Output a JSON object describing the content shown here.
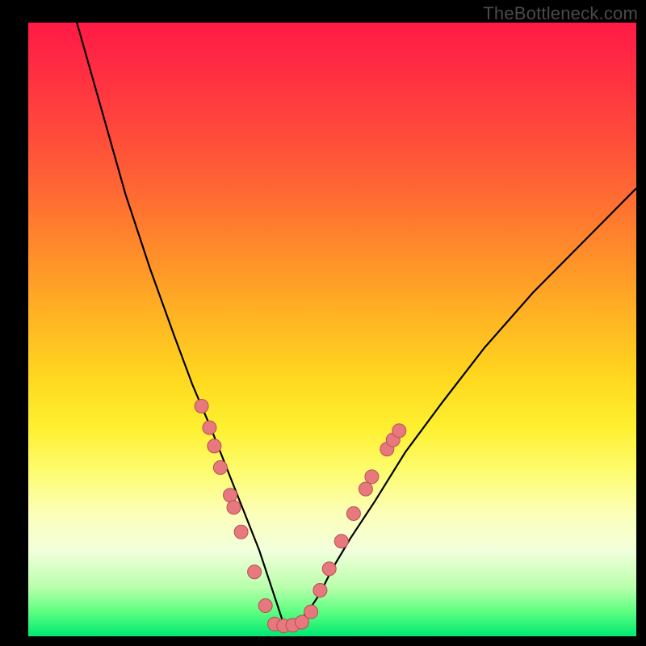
{
  "watermark": "TheBottleneck.com",
  "colors": {
    "frame_bg": "#000000",
    "curve_stroke": "#000000",
    "dot_fill": "#e6787e",
    "dot_stroke": "#b94f55"
  },
  "chart_data": {
    "type": "line",
    "title": "",
    "xlabel": "",
    "ylabel": "",
    "xlim": [
      0,
      100
    ],
    "ylim": [
      0,
      100
    ],
    "note": "Axes are unlabeled in the source image; values are geometric estimates on a 0–100 normalized scale. The curve is a V-shaped bottleneck curve with its minimum near x≈42, y≈2. Dots cluster on both flanks near the bottom and along the trough.",
    "series": [
      {
        "name": "bottleneck-curve",
        "x": [
          8,
          12,
          16,
          20,
          24,
          27,
          30,
          32,
          34,
          36,
          38,
          40,
          42,
          44,
          46,
          48,
          50,
          53,
          57,
          62,
          68,
          75,
          83,
          92,
          100
        ],
        "y": [
          100,
          86,
          72,
          60,
          49,
          41,
          34,
          29,
          24,
          19,
          14,
          8,
          2,
          2,
          4,
          7,
          11,
          16,
          22,
          30,
          38,
          47,
          56,
          65,
          73
        ]
      }
    ],
    "dots": {
      "name": "markers",
      "points": [
        {
          "x": 28.5,
          "y": 37.5
        },
        {
          "x": 29.8,
          "y": 34.0
        },
        {
          "x": 30.6,
          "y": 31.0
        },
        {
          "x": 31.6,
          "y": 27.5
        },
        {
          "x": 33.2,
          "y": 23.0
        },
        {
          "x": 33.8,
          "y": 21.0
        },
        {
          "x": 35.0,
          "y": 17.0
        },
        {
          "x": 37.2,
          "y": 10.5
        },
        {
          "x": 39.0,
          "y": 5.0
        },
        {
          "x": 40.5,
          "y": 2.0
        },
        {
          "x": 42.0,
          "y": 1.7
        },
        {
          "x": 43.5,
          "y": 1.8
        },
        {
          "x": 45.0,
          "y": 2.3
        },
        {
          "x": 46.5,
          "y": 4.0
        },
        {
          "x": 48.0,
          "y": 7.5
        },
        {
          "x": 49.5,
          "y": 11.0
        },
        {
          "x": 51.5,
          "y": 15.5
        },
        {
          "x": 53.5,
          "y": 20.0
        },
        {
          "x": 55.5,
          "y": 24.0
        },
        {
          "x": 56.5,
          "y": 26.0
        },
        {
          "x": 59.0,
          "y": 30.5
        },
        {
          "x": 60.0,
          "y": 32.0
        },
        {
          "x": 61.0,
          "y": 33.5
        }
      ]
    }
  }
}
